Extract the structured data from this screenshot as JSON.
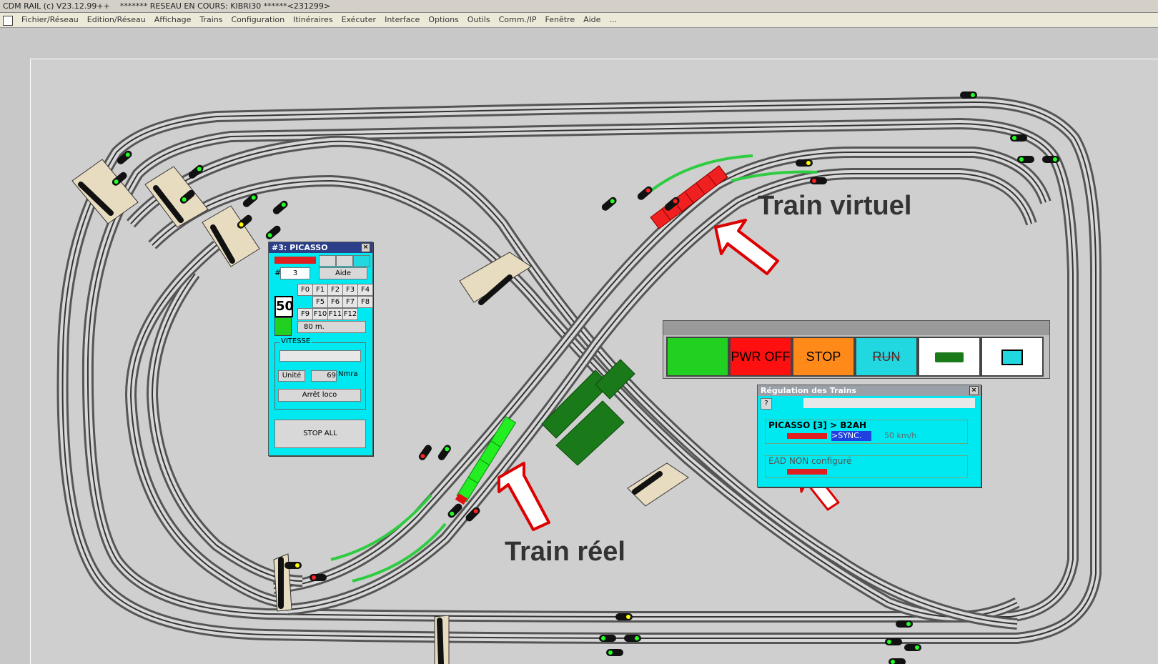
{
  "window": {
    "app_title": "CDM RAIL (c) V23.12.99++",
    "network_title": "******* RESEAU EN COURS: KIBRI30 ******<231299>"
  },
  "menu": {
    "items": [
      "Fichier/Réseau",
      "Edition/Réseau",
      "Affichage",
      "Trains",
      "Configuration",
      "Itinéraires",
      "Exécuter",
      "Interface",
      "Options",
      "Outils",
      "Comm./IP",
      "Fenêtre",
      "Aide",
      "..."
    ]
  },
  "annotations": {
    "virtual_train": "Train virtuel",
    "real_train": "Train réel"
  },
  "control_bar": {
    "pwr_off": "PWR OFF",
    "stop": "STOP",
    "run": "RUN",
    "colors": {
      "green": "#22d022",
      "pwr": "#ff1010",
      "stop": "#ff8a1a",
      "run": "#22d8e0",
      "train": "#ffffff",
      "monitor": "#ffffff"
    }
  },
  "loco_panel": {
    "title": "#3: PICASSO",
    "hash_label": "#",
    "number": "3",
    "help": "Aide",
    "function_keys": [
      "F0",
      "F1",
      "F2",
      "F3",
      "F4",
      "F5",
      "F6",
      "F7",
      "F8",
      "F9",
      "F10",
      "F11",
      "F12"
    ],
    "speed_limit": "50",
    "distance": "80 m.",
    "speed_group": "VITESSE",
    "unit_button": "Unité",
    "speed_value": "69",
    "speed_unit": "Nmra",
    "stop_loco": "Arrêt loco",
    "stop_all": "STOP ALL"
  },
  "regulation": {
    "title": "Régulation des Trains",
    "help": "?",
    "train1_name": "PICASSO [3] > B2AH",
    "train1_status": ">SYNC.",
    "train1_speed": "50 km/h",
    "train2_name": "EAD NON configuré"
  }
}
